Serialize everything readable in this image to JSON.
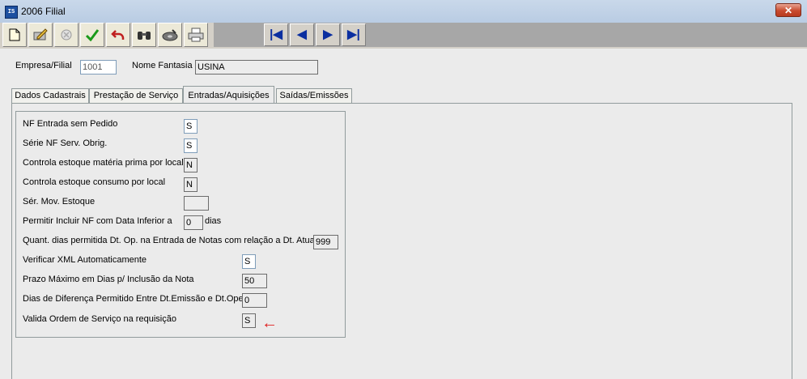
{
  "window": {
    "title": "2006 Filial",
    "app_icon": "app-icon",
    "close_label": "✕"
  },
  "toolbar": {
    "buttons": [
      "new-icon",
      "edit-icon",
      "delete-icon",
      "confirm-icon",
      "undo-icon",
      "search-icon",
      "disk-icon",
      "print-icon"
    ],
    "nav": [
      "first-record-icon",
      "previous-record-icon",
      "next-record-icon",
      "last-record-icon"
    ]
  },
  "header": {
    "empresa_label": "Empresa/Filial",
    "empresa_value": "1001",
    "fantasia_label": "Nome Fantasia",
    "fantasia_value": "USINA"
  },
  "tabs": [
    {
      "label": "Dados Cadastrais"
    },
    {
      "label": "Prestação de Serviço"
    },
    {
      "label": "Entradas/Aquisições"
    },
    {
      "label": "Saídas/Emissões"
    }
  ],
  "fields": [
    {
      "label": "NF Entrada sem Pedido",
      "value": "S"
    },
    {
      "label": "Série NF Serv. Obrig.",
      "value": "S"
    },
    {
      "label": "Controla estoque matéria prima por local",
      "value": "N"
    },
    {
      "label": "Controla estoque consumo por local",
      "value": "N"
    },
    {
      "label": "Sér. Mov. Estoque",
      "value": ""
    },
    {
      "label": "Permitir Incluir NF com Data Inferior a",
      "value": "0",
      "suffix": "dias"
    },
    {
      "label": "Quant. dias permitida Dt. Op. na Entrada de Notas com relação a Dt. Atual",
      "value": "999"
    },
    {
      "label": "Verificar XML Automaticamente",
      "value": "S"
    },
    {
      "label": "Prazo Máximo em Dias p/ Inclusão da Nota",
      "value": "50"
    },
    {
      "label": "Dias de Diferença Permitido Entre Dt.Emissão e Dt.Oper.",
      "value": "0"
    },
    {
      "label": "Valida Ordem de Serviço na requisição",
      "value": "S"
    }
  ],
  "annotation": {
    "arrow": "←",
    "color": "#e02020"
  },
  "colors": {
    "titlebar": "#c9d8ea",
    "toolbar": "#d4d0c8",
    "nav_arrow": "#0b2fa0",
    "close": "#c84b2f"
  }
}
